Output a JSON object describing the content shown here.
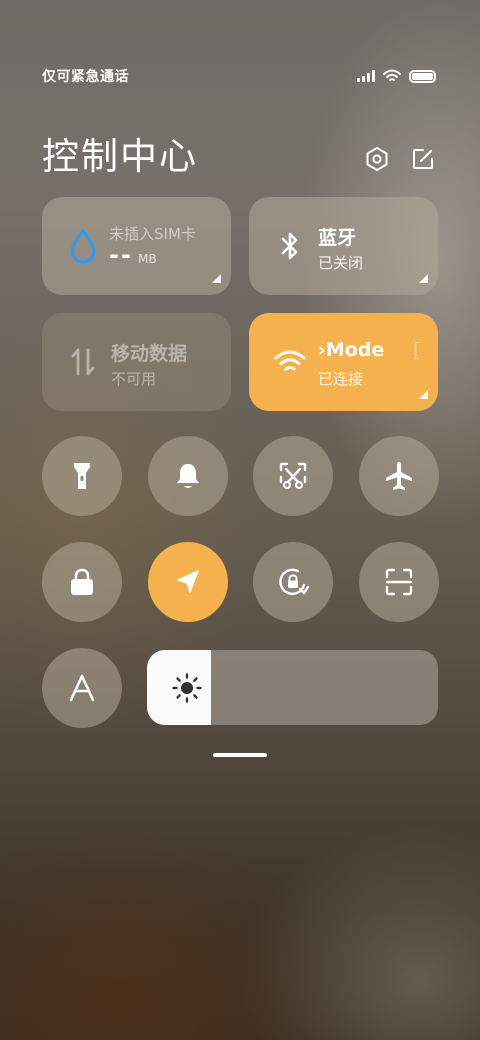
{
  "status_bar": {
    "carrier_text": "仅可紧急通话",
    "battery_level": 1.0
  },
  "header": {
    "title": "控制中心",
    "settings_icon": "hexagon-settings-icon",
    "edit_icon": "edit-icon"
  },
  "tiles": {
    "data_usage": {
      "icon": "water-drop-icon",
      "label": "未插入SIM卡",
      "value": "--",
      "unit": "MB",
      "icon_color": "#2f9bf0"
    },
    "bluetooth": {
      "icon": "bluetooth-icon",
      "title": "蓝牙",
      "status": "已关闭"
    },
    "mobile_data": {
      "icon": "mobile-data-icon",
      "title": "移动数据",
      "status": "不可用"
    },
    "wifi": {
      "icon": "wifi-icon",
      "title": "›Mode",
      "title_tail": "[",
      "status": "已连接"
    }
  },
  "toggles_row1": [
    "flashlight-icon",
    "bell-icon",
    "screenshot-icon",
    "airplane-icon"
  ],
  "toggles_row2": [
    "lock-icon",
    "location-icon",
    "rotation-lock-icon",
    "scan-icon"
  ],
  "font_button": {
    "label": "A"
  },
  "brightness": {
    "level": 0.22,
    "icon": "sun-icon"
  },
  "colors": {
    "accent": "#f5b14e",
    "tile_bg": "rgba(180,170,155,0.55)",
    "slider_fill": "#fbfafa"
  }
}
